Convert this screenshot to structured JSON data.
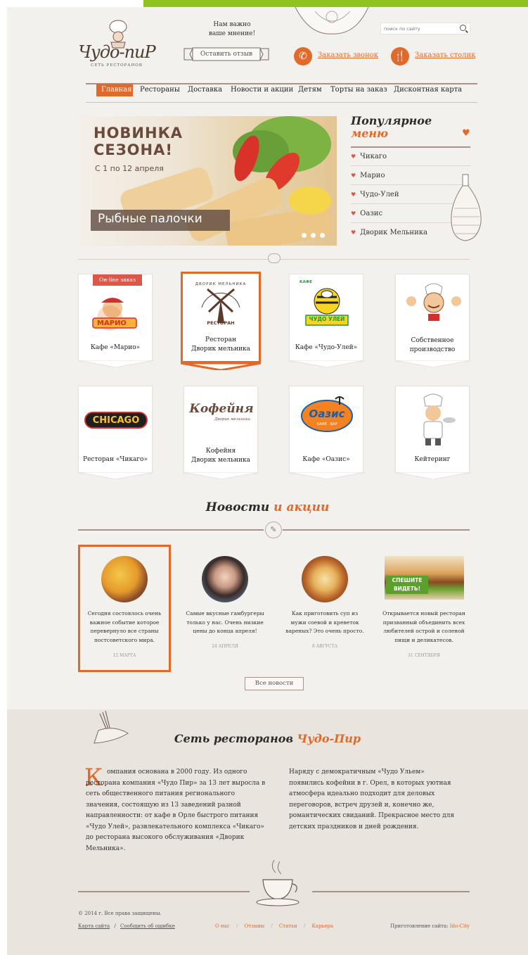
{
  "header": {
    "logo_text": "Чудо-пиР",
    "logo_sub": "СЕТЬ РЕСТОРАНОВ",
    "opinion_line1": "Нам важно",
    "opinion_line2": "ваше мнение!",
    "feedback_button": "Оставить отзыв",
    "search_placeholder": "поиск по сайту",
    "call_link": "Заказать звонок",
    "table_link": "Заказать столик"
  },
  "nav": {
    "items": [
      "Главная",
      "Рестораны",
      "Доставка",
      "Новости и акции",
      "Детям",
      "Торты на заказ",
      "Дисконтная карта"
    ]
  },
  "banner": {
    "title_line1": "НОВИНКА",
    "title_line2": "СЕЗОНА!",
    "date": "С 1 по 12 апреля",
    "dish": "Рыбные палочки"
  },
  "popular": {
    "title_part1": "Популярное",
    "title_part2": "меню",
    "items": [
      "Чикаго",
      "Марио",
      "Чудо-Улей",
      "Оазис",
      "Дворик Мельника"
    ]
  },
  "restaurants": {
    "online_badge": "Он-line заказ",
    "cards": [
      {
        "logo": "МАРИО",
        "caption": "Кафе «Марио»"
      },
      {
        "logo_top": "ДВОРИК МЕЛЬНИКА",
        "logo_bottom": "РЕСТОРАН",
        "caption1": "Ресторан",
        "caption2": "Дворик мельника"
      },
      {
        "logo": "ЧУДО УЛЕЙ",
        "logo_top": "КАФЕ",
        "caption": "Кафе «Чудо-Улей»"
      },
      {
        "caption1": "Собственное",
        "caption2": "производство"
      },
      {
        "logo": "CHICAGO",
        "caption": "Ресторан «Чикаго»"
      },
      {
        "logo": "Кофейня",
        "logo_sub": "Дворик мельника",
        "caption1": "Кофейня",
        "caption2": "Дворик мельника"
      },
      {
        "logo": "Оазис",
        "logo_sub": "КАФЕ · БАР",
        "caption": "Кафе «Оазис»"
      },
      {
        "caption": "Кейтеринг"
      }
    ]
  },
  "news": {
    "title_part1": "Новости",
    "title_part2": "и акции",
    "items": [
      {
        "text": "Сегодня состоялось очень важное событие которое перевернуло все страны постсоветского мира.",
        "date": "12 МАРТА"
      },
      {
        "text": "Самые вкусные гамбургеры только у нас. Очень низкие цены до конца апреля!",
        "date": "24 АПРЕЛЯ"
      },
      {
        "text": "Как приготовить суп из мужи соевой и креветок вареных? Это очень просто.",
        "date": "8 АВГУСТА"
      },
      {
        "text": "Открывается новый ресторан призванный объединить всех любителей острой и соленой пищи и деликатесов.",
        "date": "31 СЕНТЯБРЯ",
        "sticker": "СПЕШИТЕ ВИДЕТЬ!"
      }
    ],
    "all_button": "Все новости"
  },
  "about": {
    "title_part1": "Сеть ресторанов",
    "title_part2": "Чудо-Пир",
    "drop_cap": "К",
    "col1": "омпания основана в 2000 году. Из одного ресторана компания «Чудо Пир» за 13 лет выросла в сеть общественного питания регионального значения, состоящую из 13 заведений разной направленности: от кафе в Орле быстрого питания «Чудо Улей», развлекательного комплекса «Чикаго» до ресторана высокого обслуживания «Дворик Мельника».",
    "col2": "Наряду с демократичным «Чудо Ульем» появились кофейни в г. Орел, в которых уютная атмосфера идеально подходит для деловых переговоров, встреч друзей и, конечно же, романтических свиданий. Прекрасное место для детских праздников и дней рождения."
  },
  "footer": {
    "copyright": "© 2014 г. Все права защищены.",
    "left_links": [
      "Карта сайта",
      "Сообщить об ошибке"
    ],
    "center_links": [
      "О нас",
      "Отзывы",
      "Статьи",
      "Карьера"
    ],
    "made_by_prefix": "Приготовление сайта:",
    "made_by": "Ido-City"
  },
  "colors": {
    "accent": "#e06a2a",
    "brown": "#6b4a3a",
    "green": "#8fc31f"
  }
}
